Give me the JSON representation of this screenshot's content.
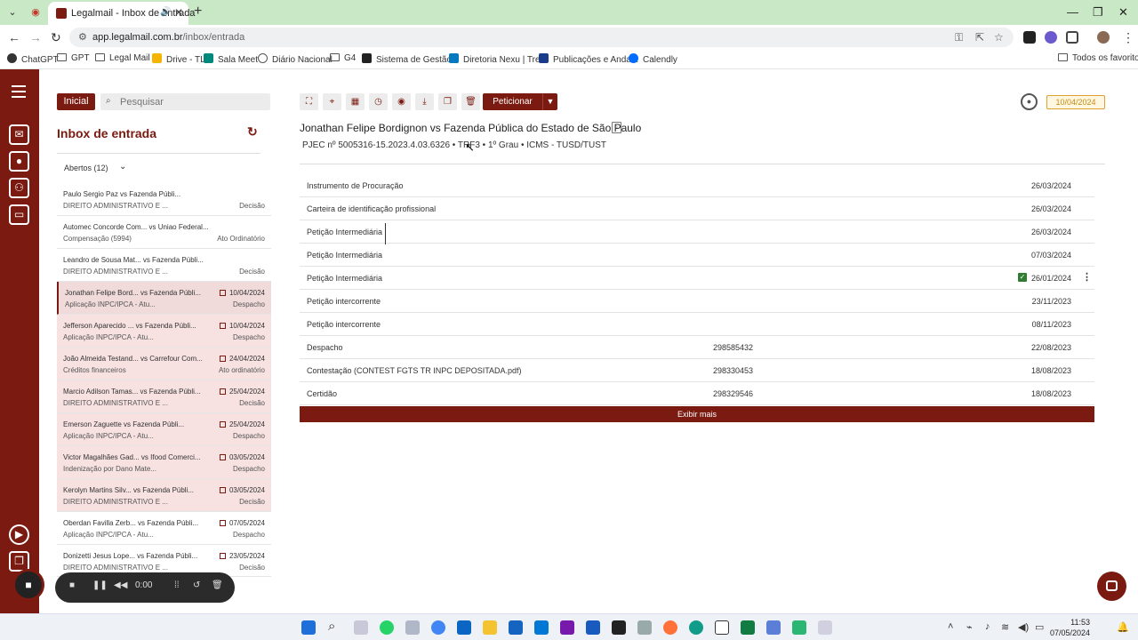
{
  "browser": {
    "tab_title": "Legalmail - Inbox de entrada",
    "url_domain": "app.legalmail.com.br",
    "url_path": "/inbox/entrada",
    "bookmarks": [
      "ChatGPT",
      "GPT",
      "Legal Mail",
      "Drive - TL",
      "Sala Meet",
      "Diário Nacional",
      "G4",
      "Sistema de Gestão...",
      "Diretoria Nexu | Trello",
      "Publicações e Anda...",
      "Calendly"
    ],
    "all_bookmarks": "Todos os favoritos"
  },
  "sidebar": {
    "home_button": "Inicial",
    "search_placeholder": "Pesquisar",
    "title": "Inbox de entrada",
    "filter_label": "Abertos (12)",
    "items": [
      {
        "title": "Paulo Sergio Paz vs Fazenda Públi...",
        "subtitle": "DIREITO ADMINISTRATIVO E ...",
        "date": "",
        "type": "Decisão"
      },
      {
        "title": "Automec Concorde Com... vs Uniao Federal...",
        "subtitle": "Compensação (5994)",
        "date": "",
        "type": "Ato Ordinatório"
      },
      {
        "title": "Leandro de Sousa Mat... vs Fazenda Públi...",
        "subtitle": "DIREITO ADMINISTRATIVO E ...",
        "date": "",
        "type": "Decisão"
      },
      {
        "title": "Jonathan Felipe Bord... vs Fazenda Públi...",
        "subtitle": "Aplicação INPC/IPCA - Atu...",
        "date": "10/04/2024",
        "type": "Despacho"
      },
      {
        "title": "Jefferson Aparecido ... vs Fazenda Públi...",
        "subtitle": "Aplicação INPC/IPCA - Atu...",
        "date": "10/04/2024",
        "type": "Despacho"
      },
      {
        "title": "João Almeida Testand... vs Carrefour Com...",
        "subtitle": "Créditos financeiros",
        "date": "24/04/2024",
        "type": "Ato ordinatório"
      },
      {
        "title": "Marcio Adilson Tamas... vs Fazenda Públi...",
        "subtitle": "DIREITO ADMINISTRATIVO E ...",
        "date": "25/04/2024",
        "type": "Decisão"
      },
      {
        "title": "Emerson Zaguette vs Fazenda Públi...",
        "subtitle": "Aplicação INPC/IPCA - Atu...",
        "date": "25/04/2024",
        "type": "Despacho"
      },
      {
        "title": "Victor Magalhães Gad... vs Ifood Comerci...",
        "subtitle": "Indenização por Dano Mate...",
        "date": "03/05/2024",
        "type": "Despacho"
      },
      {
        "title": "Kerolyn Martins Silv... vs Fazenda Públi...",
        "subtitle": "DIREITO ADMINISTRATIVO E ...",
        "date": "03/05/2024",
        "type": "Decisão"
      },
      {
        "title": "Oberdan Favilla Zerb... vs Fazenda Públi...",
        "subtitle": "Aplicação INPC/IPCA - Atu...",
        "date": "07/05/2024",
        "type": "Despacho"
      },
      {
        "title": "Donizetti Jesus Lope... vs Fazenda Públi...",
        "subtitle": "DIREITO ADMINISTRATIVO E ...",
        "date": "23/05/2024",
        "type": "Decisão"
      }
    ]
  },
  "recorder": {
    "time": "0:00"
  },
  "main": {
    "peticionar_label": "Peticionar",
    "header_date": "10/04/2024",
    "case_title": "Jonathan Felipe Bordignon vs Fazenda Pública do Estado de São Paulo",
    "case_subtitle": "PJEC  nº  5005316-15.2023.4.03.6326  •  TRF3  •  1º Grau  •  ICMS - TUSD/TUST",
    "documents": [
      {
        "name": "Instrumento de Procuração",
        "number": "",
        "date": "26/03/2024"
      },
      {
        "name": "Carteira de identificação profissional",
        "number": "",
        "date": "26/03/2024"
      },
      {
        "name": "Petição Intermediária",
        "number": "",
        "date": "26/03/2024"
      },
      {
        "name": "Petição Intermediária",
        "number": "",
        "date": "07/03/2024"
      },
      {
        "name": "Petição Intermediária",
        "number": "",
        "date": "26/01/2024"
      },
      {
        "name": "Petição intercorrente",
        "number": "",
        "date": "23/11/2023"
      },
      {
        "name": "Petição intercorrente",
        "number": "",
        "date": "08/11/2023"
      },
      {
        "name": "Despacho",
        "number": "298585432",
        "date": "22/08/2023"
      },
      {
        "name": "Contestação (CONTEST FGTS TR INPC DEPOSITADA.pdf)",
        "number": "298330453",
        "date": "18/08/2023"
      },
      {
        "name": "Certidão",
        "number": "298329546",
        "date": "18/08/2023"
      }
    ],
    "show_more": "Exibir mais"
  },
  "taskbar": {
    "time": "11:53",
    "date": "07/05/2024"
  },
  "colors": {
    "brand": "#7a1a10",
    "highlight_row": "#f7e1e1",
    "date_badge": "#e0a030"
  }
}
